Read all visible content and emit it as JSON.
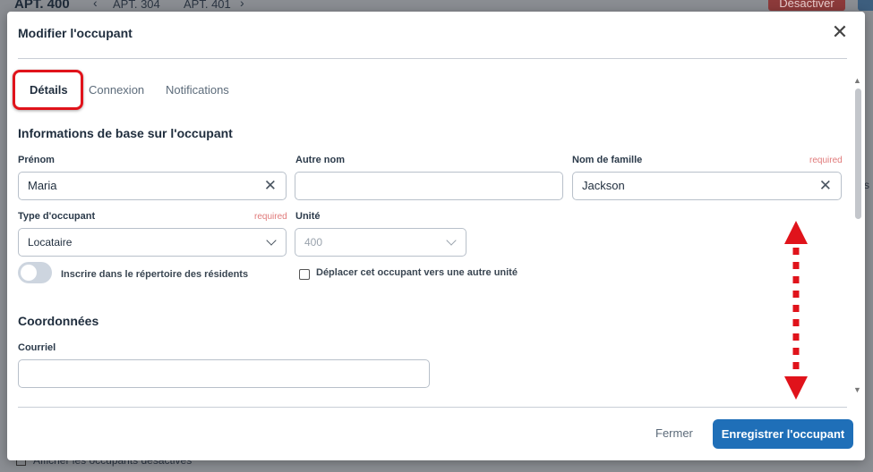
{
  "background": {
    "title": "APT. 400",
    "nav": [
      "APT. 304",
      "APT. 401"
    ],
    "deactivate_label": "Désactiver",
    "footer_checkbox_label": "Afficher les occupants désactivés",
    "edge_text": "s"
  },
  "modal": {
    "title": "Modifier l'occupant",
    "tabs": [
      {
        "label": "Détails",
        "active": true
      },
      {
        "label": "Connexion",
        "active": false
      },
      {
        "label": "Notifications",
        "active": false
      }
    ],
    "section_basic": "Informations de base sur l'occupant",
    "fields": {
      "first_name": {
        "label": "Prénom",
        "value": "Maria"
      },
      "other_name": {
        "label": "Autre nom",
        "value": ""
      },
      "last_name": {
        "label": "Nom de famille",
        "value": "Jackson",
        "required": "required"
      },
      "occupant_type": {
        "label": "Type d'occupant",
        "value": "Locataire",
        "required": "required"
      },
      "unit": {
        "label": "Unité",
        "value": "400"
      },
      "email": {
        "label": "Courriel",
        "value": ""
      }
    },
    "toggle_label": "Inscrire dans le répertoire des résidents",
    "checkbox_label": "Déplacer cet occupant vers une autre unité",
    "section_contact": "Coordonnées",
    "close_button": "Fermer",
    "save_button": "Enregistrer l'occupant"
  },
  "colors": {
    "primary": "#1f6fb8",
    "highlight": "#e0131b",
    "required": "#e07a7a"
  },
  "icons": [
    "close-icon",
    "clear-icon",
    "chevron-down-icon",
    "scroll-up-icon",
    "scroll-down-icon",
    "double-arrow-icon"
  ]
}
